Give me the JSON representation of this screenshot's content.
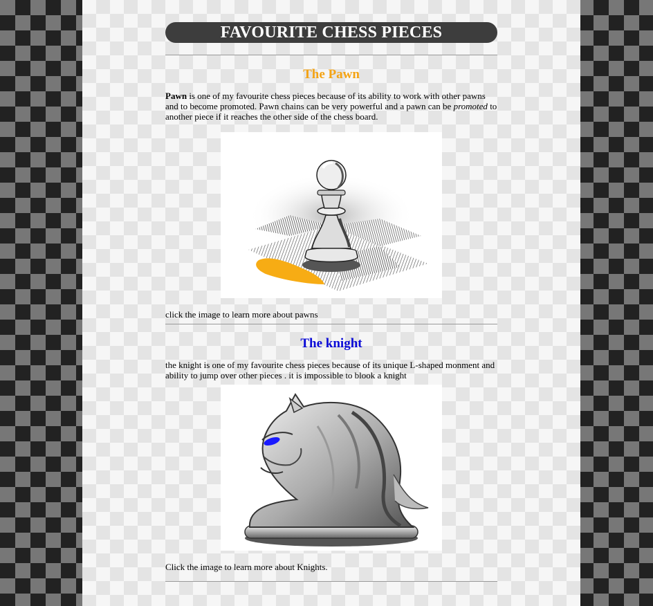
{
  "header": {
    "title": "FAVOURITE CHESS PIECES"
  },
  "pawn": {
    "heading": "The Pawn",
    "bold_word": "Pawn",
    "text_a": " is one of my favourite chess pieces because of its ability to work with other pawns and to become promoted. Pawn chains can be very powerful and a pawn can be ",
    "italic_word": "promoted",
    "text_b": " to another piece if it reaches the other side of the chess board.",
    "caption": "click the image to learn more about pawns",
    "accent_color": "#f4a314"
  },
  "knight": {
    "heading": "The knight",
    "text": "the knight is one of my favourite chess pieces because of its unique L-shaped monment and ability to jump over other pieces . it is impossible to blook a knight",
    "caption": "Click the image to learn more about Knights.",
    "accent_color": "#0a0ad6"
  }
}
